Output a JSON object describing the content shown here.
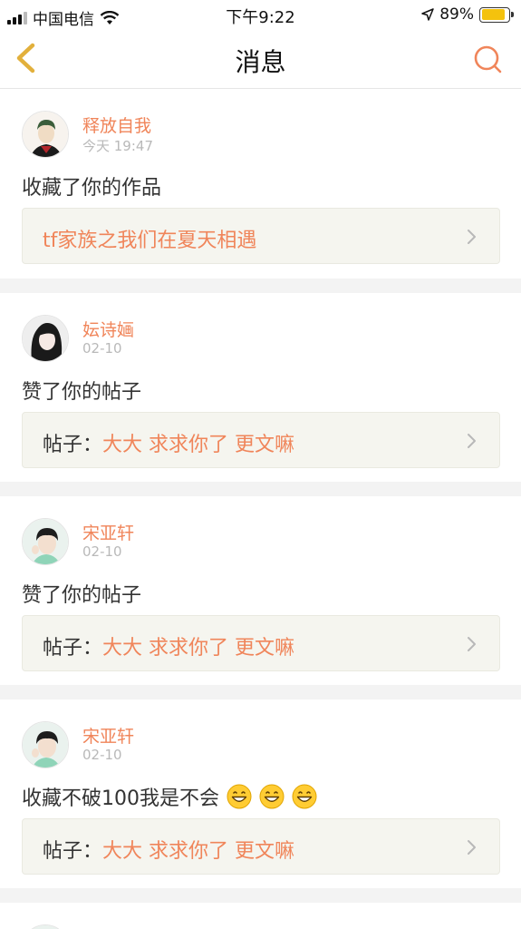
{
  "status_bar": {
    "carrier": "中国电信",
    "time": "下午9:22",
    "battery": "89%",
    "battery_level": 0.89
  },
  "nav": {
    "title": "消息",
    "back_icon": "chevron-left-icon",
    "search_icon": "search-icon"
  },
  "colors": {
    "accent": "#f0855a",
    "back_arrow": "#e2b03c",
    "battery": "#f4c20d"
  },
  "messages": [
    {
      "user": "释放自我",
      "time": "今天 19:47",
      "action": "收藏了你的作品",
      "ref_prefix": "",
      "ref_text": "tf家族之我们在夏天相遇"
    },
    {
      "user": "妘诗婳",
      "time": "02-10",
      "action": "赞了你的帖子",
      "ref_prefix": "帖子：",
      "ref_text": "大大 求求你了 更文嘛"
    },
    {
      "user": "宋亚轩",
      "time": "02-10",
      "action": "赞了你的帖子",
      "ref_prefix": "帖子：",
      "ref_text": "大大 求求你了 更文嘛"
    },
    {
      "user": "宋亚轩",
      "time": "02-10",
      "action": "收藏不破100我是不会",
      "ref_prefix": "帖子：",
      "ref_text": "大大 求求你了 更文嘛",
      "emoji": [
        "grinning-face-icon",
        "grinning-face-icon",
        "grinning-face-icon"
      ]
    }
  ]
}
